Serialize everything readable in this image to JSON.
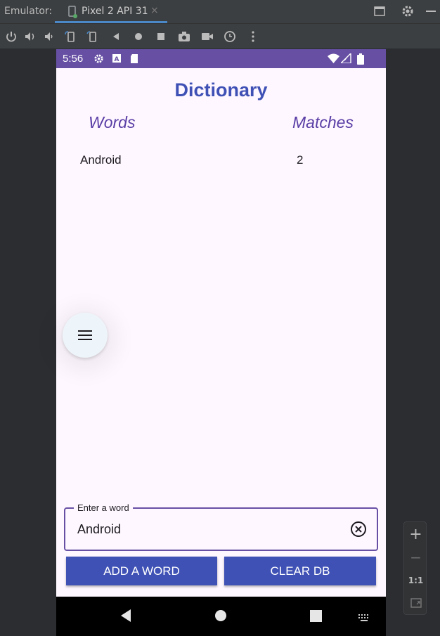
{
  "title_bar": {
    "label": "Emulator:",
    "tab_label": "Pixel 2 API 31",
    "tab_close": "×",
    "icons": [
      "device-icon",
      "restore-window-icon",
      "gear-icon",
      "minimize-icon"
    ]
  },
  "toolbar": {
    "icons": [
      "power-icon",
      "volume-up-icon",
      "volume-down-icon",
      "rotate-left-icon",
      "rotate-right-icon",
      "back-icon",
      "home-icon",
      "overview-icon",
      "camera-icon",
      "video-icon",
      "snapshot-icon",
      "more-icon"
    ]
  },
  "status_bar": {
    "time": "5:56",
    "icons": [
      "gear-icon",
      "a-icon",
      "sd-card-icon",
      "wifi-icon",
      "signal-icon",
      "battery-icon"
    ]
  },
  "app": {
    "title": "Dictionary",
    "columns": [
      "Words",
      "Matches"
    ],
    "rows": [
      {
        "word": "Android",
        "matches": "2"
      }
    ],
    "fab_icon": "menu-icon",
    "input": {
      "label": "Enter a word",
      "value": "Android",
      "clear_icon": "clear-circle-icon"
    },
    "buttons": {
      "add": "ADD A WORD",
      "clear": "CLEAR DB"
    }
  },
  "nav_bar": {
    "icons": [
      "back-icon",
      "home-icon",
      "recents-icon",
      "keyboard-icon"
    ]
  },
  "zoom_panel": {
    "zoom_in": "+",
    "zoom_out": "−",
    "one_to_one": "1:1",
    "fit_icon": "fit-screen-icon"
  },
  "colors": {
    "status_bar": "#6750a4",
    "app_background": "#fef7ff",
    "title": "#3f51b5",
    "column_header": "#5a3ea6",
    "button": "#3f51b5",
    "field_border": "#6750a4"
  }
}
